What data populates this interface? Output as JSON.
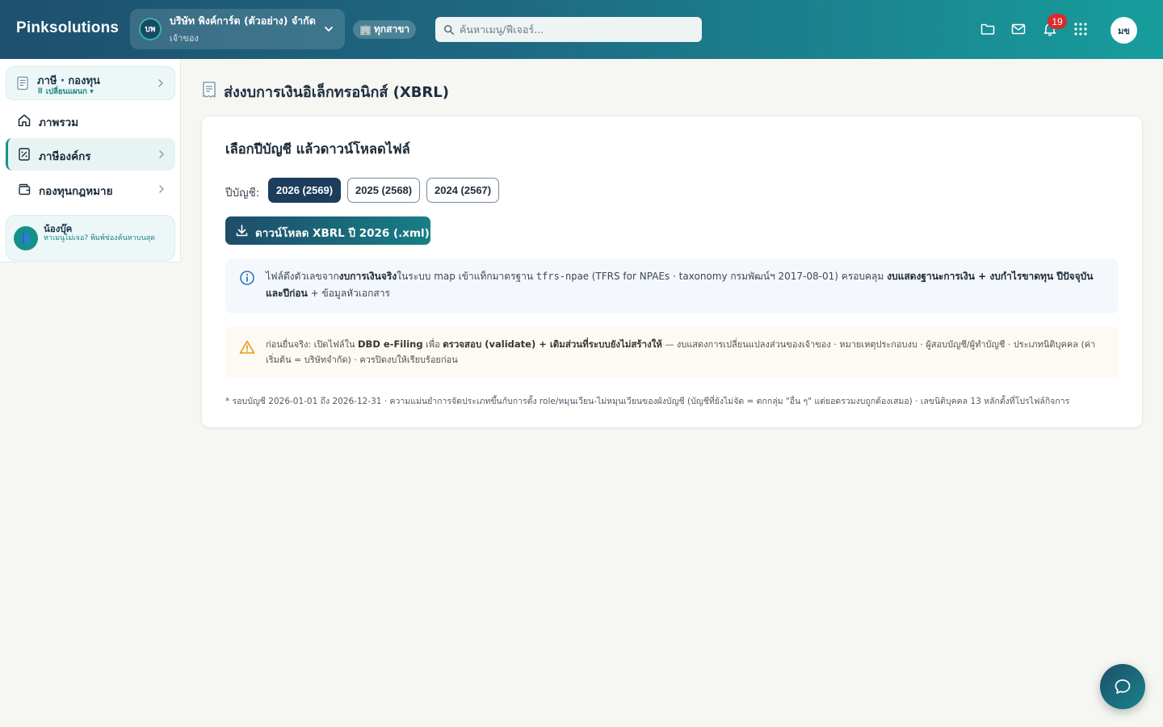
{
  "header": {
    "brand": "Pinksolutions",
    "company": {
      "avatar_initials": "บพ",
      "name": "บริษัท พิงค์การ์ด (ตัวอย่าง) จำกัด",
      "role": "เจ้าของ"
    },
    "branch": {
      "icon": "🏢",
      "label": "ทุกสาขา"
    },
    "search": {
      "placeholder": "ค้นหาเมนู/ฟีเจอร์..."
    },
    "notification_count": "19",
    "user_initials": "มข"
  },
  "sidebar": {
    "module": {
      "title": "ภาษี · กองทุน",
      "subtitle": "⠿ เปลี่ยนแผนก ▾"
    },
    "items": [
      {
        "label": "ภาพรวม",
        "icon": "home-icon",
        "active": false
      },
      {
        "label": "ภาษีองค์กร",
        "icon": "tax-receipt-icon",
        "active": true
      },
      {
        "label": "กองทุนกฎหมาย",
        "icon": "wallet-icon",
        "active": false
      }
    ],
    "assistant": {
      "name": "น้องบุ๊ค",
      "hint": "หาเมนูไม่เจอ? พิมพ์ช่องค้นหาบนสุด"
    }
  },
  "page": {
    "title": "ส่งงบการเงินอิเล็กทรอนิกส์ (XBRL)"
  },
  "card": {
    "title": "เลือกปีบัญชี แล้วดาวน์โหลดไฟล์",
    "year_label": "ปีบัญชี:",
    "years": [
      {
        "label": "2026 (2569)",
        "selected": true
      },
      {
        "label": "2025 (2568)",
        "selected": false
      },
      {
        "label": "2024 (2567)",
        "selected": false
      }
    ],
    "download_label": "ดาวน์โหลด XBRL ปี 2026 (.xml)",
    "info": {
      "t1": "ไฟล์ดึงตัวเลขจาก",
      "b1": "งบการเงินจริง",
      "t2": "ในระบบ map เข้าแท็กมาตรฐาน ",
      "code": "tfrs-npae",
      "t3": " (TFRS for NPAEs · taxonomy กรมพัฒน์ฯ 2017-08-01) ครอบคลุม ",
      "b2": "งบแสดงฐานะการเงิน + งบกำไรขาดทุน ปีปัจจุบันและปีก่อน",
      "t4": " + ข้อมูลหัวเอกสาร"
    },
    "warning": {
      "t1": "ก่อนยื่นจริง: เปิดไฟล์ใน ",
      "b1": "DBD e-Filing",
      "t2": " เพื่อ ",
      "b2": "ตรวจสอบ (validate) + เติมส่วนที่ระบบยังไม่สร้างให้",
      "t3": " — งบแสดงการเปลี่ยนแปลงส่วนของเจ้าของ · หมายเหตุประกอบงบ · ผู้สอบบัญชี/ผู้ทำบัญชี · ประเภทนิติบุคคล (ค่าเริ่มต้น = บริษัทจำกัด) · ควรปิดงบให้เรียบร้อยก่อน"
    },
    "footnote": "* รอบบัญชี 2026-01-01 ถึง 2026-12-31 · ความแม่นยำการจัดประเภทขึ้นกับการตั้ง role/หมุนเวียน-ไม่หมุนเวียนของผังบัญชี (บัญชีที่ยังไม่จัด = ตกกลุ่ม \"อื่น ๆ\" แต่ยอดรวมงบถูกต้องเสมอ) · เลขนิติบุคคล 13 หลักตั้งที่โปรไฟล์กิจการ"
  },
  "colors": {
    "header_start": "#1d4f6e",
    "header_end": "#179d9c",
    "accent": "#18918a",
    "primary_dark": "#1c3d5c",
    "badge": "#d92b2b"
  }
}
